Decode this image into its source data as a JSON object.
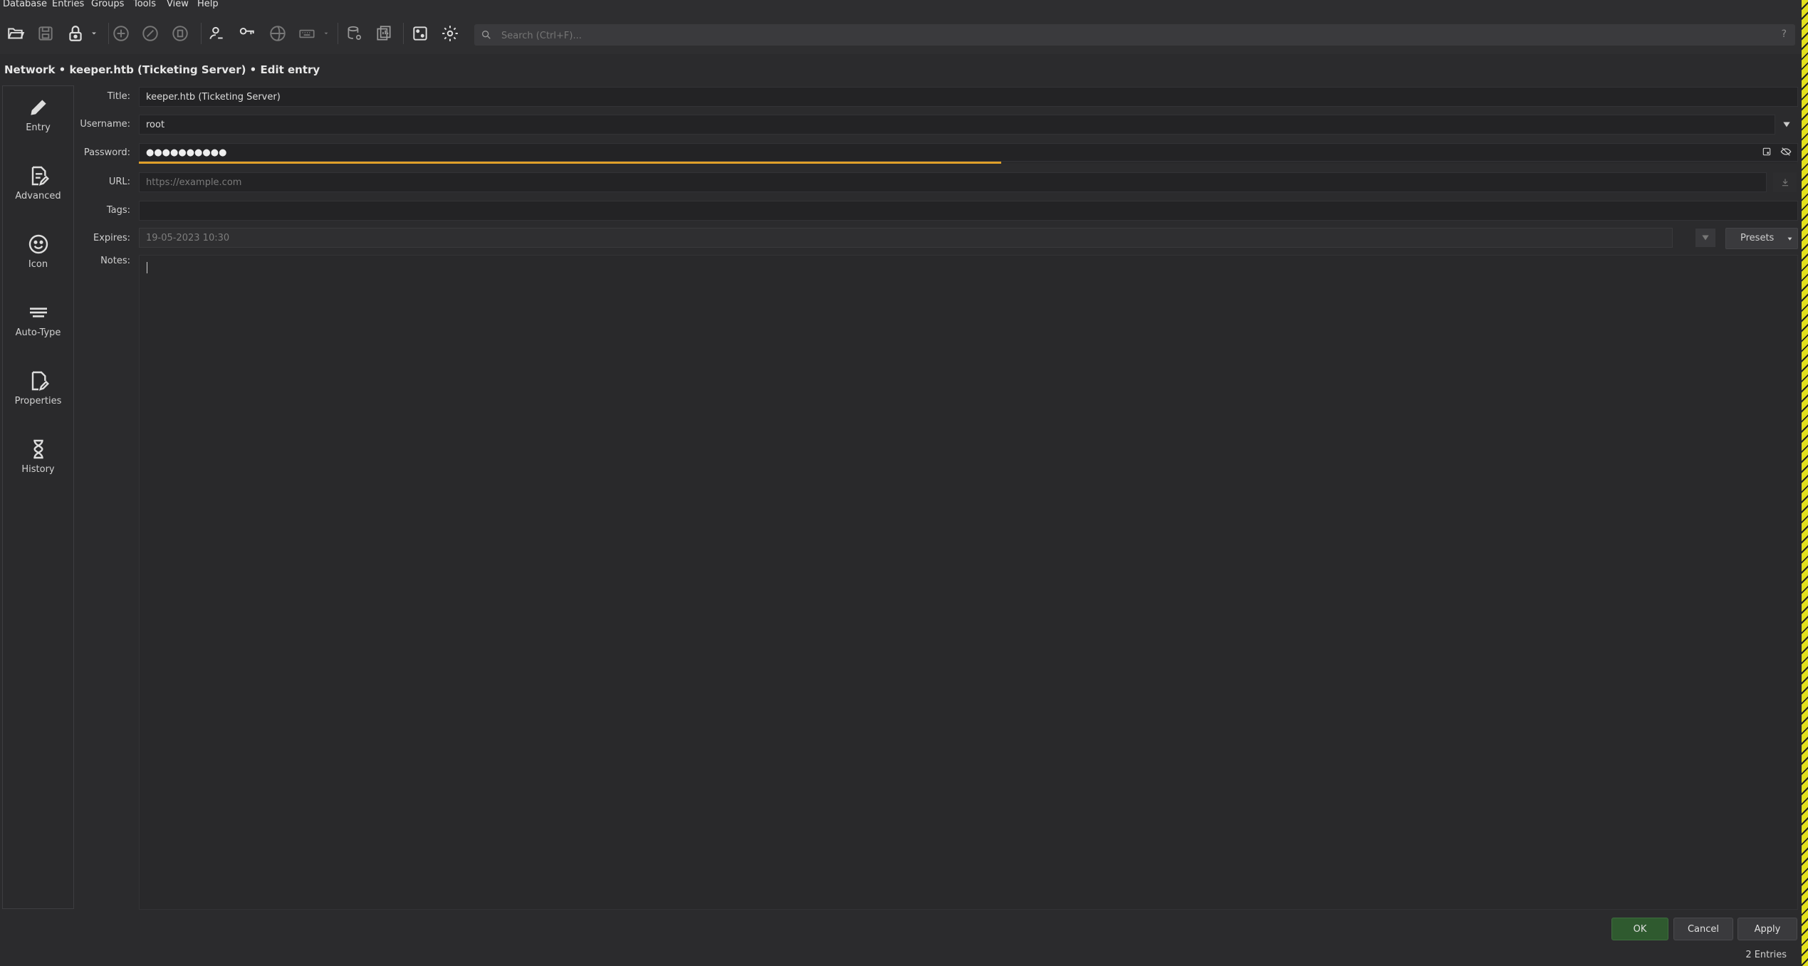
{
  "menubar": {
    "items": [
      "Database",
      "Entries",
      "Groups",
      "Tools",
      "View",
      "Help"
    ]
  },
  "toolbar": {
    "icons": [
      "folder-open-icon",
      "save-icon",
      "lock-icon",
      "add-entry-icon",
      "edit-entry-icon",
      "delete-entry-icon",
      "user-copy-icon",
      "key-copy-icon",
      "url-open-icon",
      "keyboard-autotype-icon",
      "database-settings-icon",
      "reports-icon",
      "password-generator-icon",
      "settings-gear-icon"
    ],
    "search_placeholder": "Search (Ctrl+F)...",
    "help": "?"
  },
  "header": {
    "title": "Network • keeper.htb (Ticketing Server) • Edit entry"
  },
  "sidebar": {
    "items": [
      {
        "label": "Entry",
        "icon": "pencil-icon"
      },
      {
        "label": "Advanced",
        "icon": "document-edit-icon"
      },
      {
        "label": "Icon",
        "icon": "smiley-icon"
      },
      {
        "label": "Auto-Type",
        "icon": "keyboard-icon"
      },
      {
        "label": "Properties",
        "icon": "file-edit-icon"
      },
      {
        "label": "History",
        "icon": "hourglass-icon"
      }
    ]
  },
  "form": {
    "title_label": "Title:",
    "title_value": "keeper.htb (Ticketing Server)",
    "username_label": "Username:",
    "username_value": "root",
    "password_label": "Password:",
    "password_value": "●●●●●●●●●●",
    "password_strength": 0.52,
    "url_label": "URL:",
    "url_placeholder": "https://example.com",
    "tags_label": "Tags:",
    "tags_value": "",
    "expires_label": "Expires:",
    "expires_checked": false,
    "expires_value": "19-05-2023 10:30",
    "presets_label": "Presets",
    "notes_label": "Notes:",
    "notes_value": ""
  },
  "buttons": {
    "ok": "OK",
    "cancel": "Cancel",
    "apply": "Apply"
  },
  "status": {
    "entries": "2 Entries"
  },
  "colors": {
    "accent_ok": "#2f5a2f",
    "strength_bar": "#e0a02a",
    "edge": "#e2e01c"
  }
}
